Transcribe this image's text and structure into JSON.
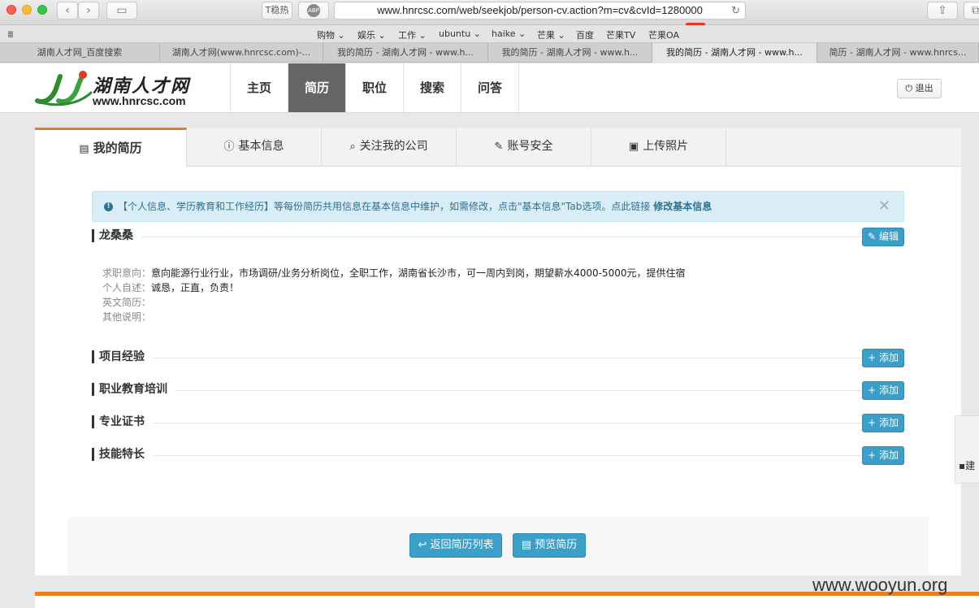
{
  "browser": {
    "url": "www.hnrcsc.com/web/seekjob/person-cv.action?m=cv&cvId=1280000",
    "btn_text": "T稳热",
    "btn_abp": "ABP",
    "bookmarks": [
      "购物 ⌄",
      "娱乐 ⌄",
      "工作 ⌄",
      "ubuntu ⌄",
      "haike ⌄",
      "芒果 ⌄",
      "百度",
      "芒果TV",
      "芒果OA"
    ],
    "tabs": [
      {
        "label": "湖南人才网_百度搜索"
      },
      {
        "label": "湖南人才网(www.hnrcsc.com)-..."
      },
      {
        "label": "我的简历 - 湖南人才网 - www.h..."
      },
      {
        "label": "我的简历 - 湖南人才网 - www.h..."
      },
      {
        "label": "我的简历 - 湖南人才网 - www.h..."
      },
      {
        "label": "简历 - 湖南人才网 - www.hnrcs..."
      }
    ]
  },
  "header": {
    "logo_title": "湖南人才网",
    "logo_url": "www.hnrcsc.com",
    "nav": [
      "主页",
      "简历",
      "职位",
      "搜索",
      "问答"
    ],
    "active_nav": "简历",
    "logout": "退出"
  },
  "tabs": [
    {
      "icon": "file-icon",
      "label": "我的简历"
    },
    {
      "icon": "info-icon",
      "label": "基本信息"
    },
    {
      "icon": "search-icon",
      "label": "关注我的公司"
    },
    {
      "icon": "wrench-icon",
      "label": "账号安全"
    },
    {
      "icon": "image-icon",
      "label": "上传照片"
    }
  ],
  "alert": {
    "text": "【个人信息、学历教育和工作经历】等每份简历共用信息在基本信息中维护，如需修改，点击\"基本信息\"Tab选项。点此链接",
    "link": "修改基本信息"
  },
  "resume": {
    "name": "龙桑桑",
    "edit_label": "编辑",
    "rows": [
      {
        "label": "求职意向：",
        "value": "意向能源行业行业，市场调研/业务分析岗位，全职工作，湖南省长沙市，可一周内到岗，期望薪水4000-5000元，提供住宿"
      },
      {
        "label": "个人自述：",
        "value": "诚恳，正直，负责！"
      },
      {
        "label": "英文简历：",
        "value": ""
      },
      {
        "label": "其他说明：",
        "value": ""
      }
    ]
  },
  "sections": [
    {
      "title": "项目经验",
      "button": "添加"
    },
    {
      "title": "职业教育培训",
      "button": "添加"
    },
    {
      "title": "专业证书",
      "button": "添加"
    },
    {
      "title": "技能特长",
      "button": "添加"
    }
  ],
  "footer": {
    "back_label": "返回简历列表",
    "preview_label": "预览简历"
  },
  "side_widget": {
    "label": "建"
  },
  "watermark": "www.wooyun.org",
  "colors": {
    "accent": "#e67e22",
    "button": "#3a9fc9",
    "alert_bg": "#d9edf7",
    "arrow": "#e8391f"
  }
}
